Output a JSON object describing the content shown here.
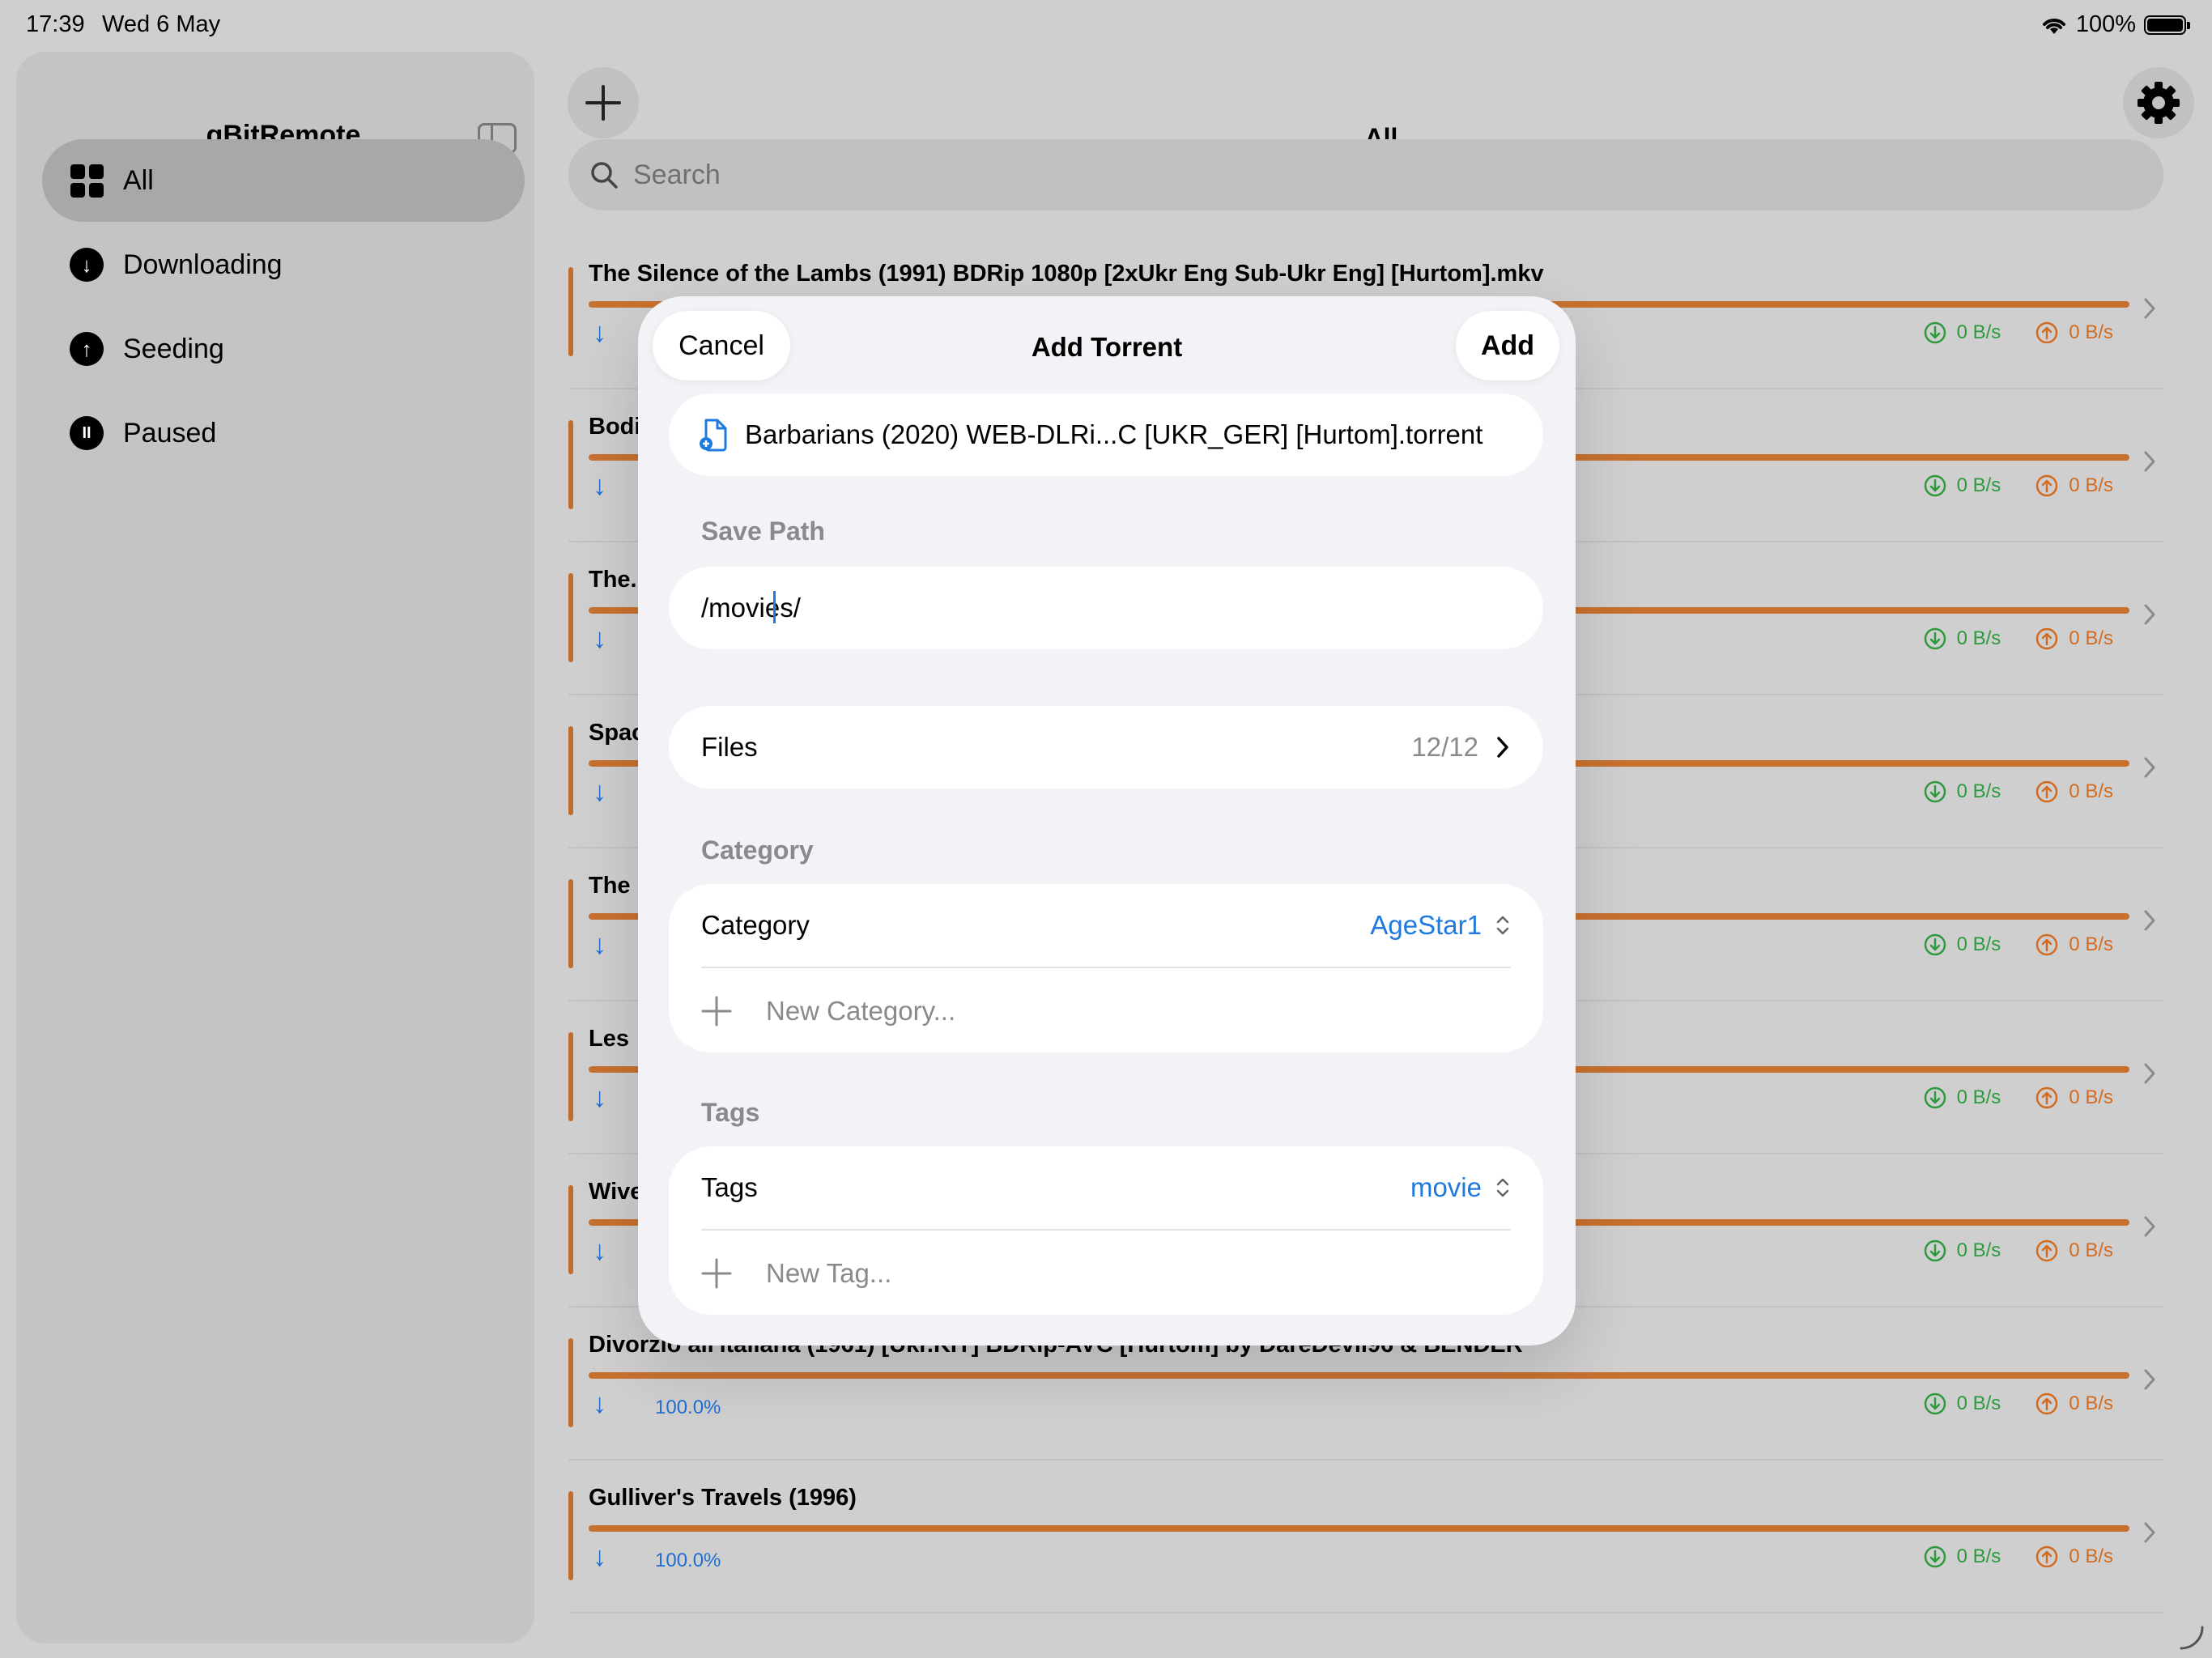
{
  "status": {
    "time": "17:39",
    "date": "Wed 6 May",
    "battery": "100%"
  },
  "sidebar": {
    "title": "qBitRemote",
    "items": [
      {
        "label": "All",
        "icon": "grid-icon"
      },
      {
        "label": "Downloading",
        "icon": "arrow-down-circle-icon"
      },
      {
        "label": "Seeding",
        "icon": "arrow-up-circle-icon"
      },
      {
        "label": "Paused",
        "icon": "pause-circle-icon"
      }
    ]
  },
  "main": {
    "title": "All",
    "search_placeholder": "Search",
    "rows": [
      {
        "name": "The Silence of the Lambs (1991) BDRip 1080p [2xUkr Eng Sub-Ukr Eng] [Hurtom].mkv",
        "progress": "",
        "down": "0 B/s",
        "up": "0 B/s"
      },
      {
        "name": "Bodi",
        "progress": "",
        "down": "0 B/s",
        "up": "0 B/s"
      },
      {
        "name": "The.",
        "progress": "",
        "down": "0 B/s",
        "up": "0 B/s"
      },
      {
        "name": "Spac",
        "progress": "",
        "down": "0 B/s",
        "up": "0 B/s"
      },
      {
        "name": "The",
        "progress": "",
        "down": "0 B/s",
        "up": "0 B/s"
      },
      {
        "name": "Les",
        "progress": "",
        "down": "0 B/s",
        "up": "0 B/s"
      },
      {
        "name": "Wive",
        "progress": "",
        "down": "0 B/s",
        "up": "0 B/s"
      },
      {
        "name": "Divorzio all'italiana (1961) [Ukr.KIT] BDRip-AVC [Hurtom] by DareDevil96 & BENDER",
        "progress": "100.0%",
        "down": "0 B/s",
        "up": "0 B/s"
      },
      {
        "name": "Gulliver's Travels (1996)",
        "progress": "100.0%",
        "down": "0 B/s",
        "up": "0 B/s"
      }
    ]
  },
  "modal": {
    "title": "Add Torrent",
    "cancel": "Cancel",
    "add": "Add",
    "file_name": "Barbarians (2020) WEB-DLRi...C [UKR_GER] [Hurtom].torrent",
    "save_path_header": "Save Path",
    "save_path_value": "/movies/",
    "files_label": "Files",
    "files_count": "12/12",
    "category_header": "Category",
    "category_label": "Category",
    "category_value": "AgeStar1",
    "new_category": "New Category...",
    "tags_header": "Tags",
    "tags_label": "Tags",
    "tags_value": "movie",
    "new_tag": "New Tag..."
  },
  "colors": {
    "accent": "#1f7ae0",
    "progress": "#c8712f",
    "download": "#2d9a3d",
    "upload": "#d26b1f"
  }
}
